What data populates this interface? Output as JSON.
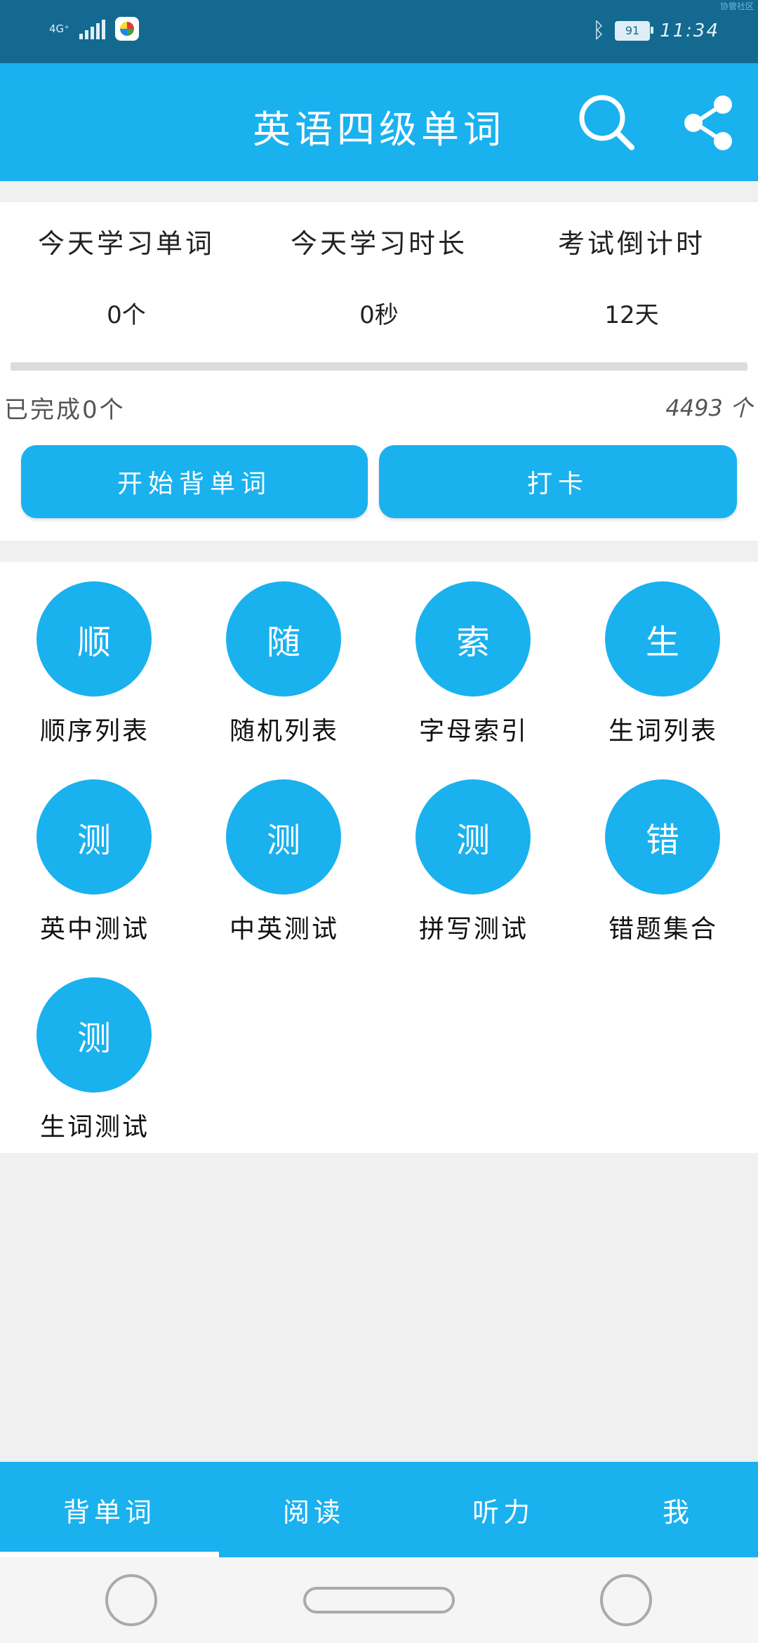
{
  "status_bar": {
    "network": "4G⁺",
    "time": "11:34",
    "battery": "91",
    "corner_text": "协管社区"
  },
  "app_bar": {
    "title": "英语四级单词",
    "search_icon": "search-icon",
    "share_icon": "share-icon"
  },
  "stats": [
    {
      "label": "今天学习单词",
      "value": "0个"
    },
    {
      "label": "今天学习时长",
      "value": "0秒"
    },
    {
      "label": "考试倒计时",
      "value": "12天"
    }
  ],
  "progress": {
    "done_text": "已完成0个",
    "total_text": "4493 个",
    "fraction": 0
  },
  "actions": {
    "start_label": "开始背单词",
    "checkin_label": "打卡"
  },
  "grid": [
    {
      "glyph": "顺",
      "label": "顺序列表"
    },
    {
      "glyph": "随",
      "label": "随机列表"
    },
    {
      "glyph": "索",
      "label": "字母索引"
    },
    {
      "glyph": "生",
      "label": "生词列表"
    },
    {
      "glyph": "测",
      "label": "英中测试"
    },
    {
      "glyph": "测",
      "label": "中英测试"
    },
    {
      "glyph": "测",
      "label": "拼写测试"
    },
    {
      "glyph": "错",
      "label": "错题集合"
    },
    {
      "glyph": "测",
      "label": "生词测试"
    }
  ],
  "tabs": [
    {
      "label": "背单词",
      "selected": true
    },
    {
      "label": "阅读",
      "selected": false
    },
    {
      "label": "听力",
      "selected": false
    },
    {
      "label": "我",
      "selected": false
    }
  ],
  "colors": {
    "primary": "#1ab1ef",
    "status_bar": "#13698f",
    "background": "#f0f0f0"
  }
}
